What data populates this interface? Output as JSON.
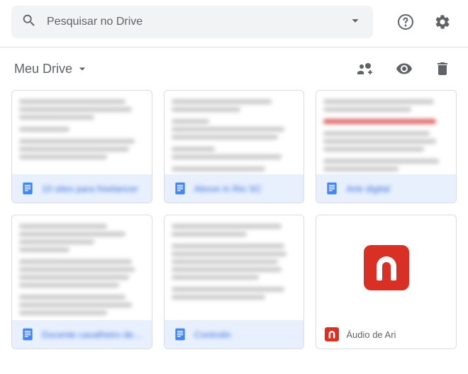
{
  "header": {
    "search_placeholder": "Pesquisar no Drive"
  },
  "breadcrumb": {
    "label": "Meu Drive"
  },
  "files": {
    "row1": [
      {
        "label": "10 sites para freelancer"
      },
      {
        "label": "Above in Rio SC"
      },
      {
        "label": "Arte digital"
      }
    ],
    "row2": [
      {
        "label": "Docente cavalheiro dese..."
      },
      {
        "label": "Controlin"
      },
      {
        "label": "Áudio de Ari",
        "type": "audio"
      }
    ]
  },
  "icons": {
    "search": "search",
    "dropdown": "dropdown",
    "help": "help",
    "settings": "settings",
    "share": "share",
    "preview": "preview",
    "delete": "delete"
  }
}
